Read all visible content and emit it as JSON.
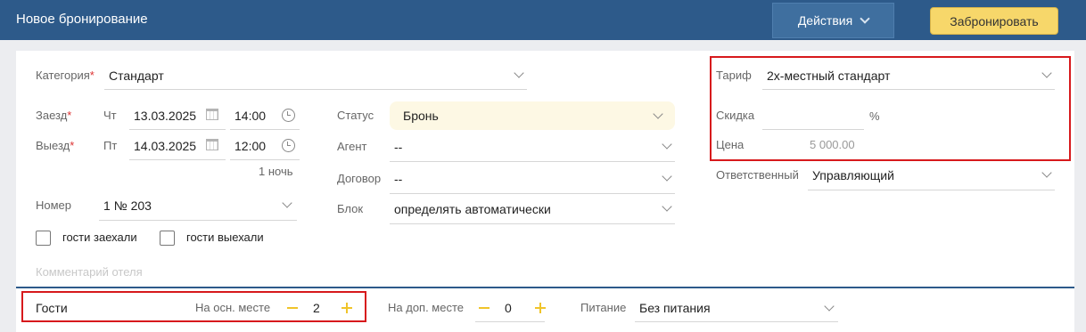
{
  "header": {
    "title": "Новое бронирование",
    "actions_label": "Действия",
    "book_label": "Забронировать"
  },
  "category": {
    "label": "Категория",
    "value": "Стандарт"
  },
  "checkin": {
    "label": "Заезд",
    "weekday": "Чт",
    "date": "13.03.2025",
    "time": "14:00"
  },
  "checkout": {
    "label": "Выезд",
    "weekday": "Пт",
    "date": "14.03.2025",
    "time": "12:00"
  },
  "nights": "1 ночь",
  "room": {
    "label": "Номер",
    "value": "1 № 203"
  },
  "checkboxes": {
    "guests_in": "гости заехали",
    "guests_out": "гости выехали"
  },
  "comment_placeholder": "Комментарий отеля",
  "status": {
    "label": "Статус",
    "value": "Бронь"
  },
  "agent": {
    "label": "Агент",
    "value": "--"
  },
  "contract": {
    "label": "Договор",
    "value": "--"
  },
  "block": {
    "label": "Блок",
    "value": "определять автоматически"
  },
  "tariff": {
    "label": "Тариф",
    "value": "2х-местный стандарт"
  },
  "discount": {
    "label": "Скидка",
    "value": "",
    "unit": "%"
  },
  "price": {
    "label": "Цена",
    "value": "5 000.00"
  },
  "responsible": {
    "label": "Ответственный",
    "value": "Управляющий"
  },
  "guests": {
    "label": "Гости",
    "main_label": "На осн. месте",
    "main_value": "2",
    "extra_label": "На доп. месте",
    "extra_value": "0",
    "meal_label": "Питание",
    "meal_value": "Без питания"
  },
  "colors": {
    "header": "#2d5a8a",
    "accent": "#f7d76a",
    "highlight": "#d7191c"
  }
}
